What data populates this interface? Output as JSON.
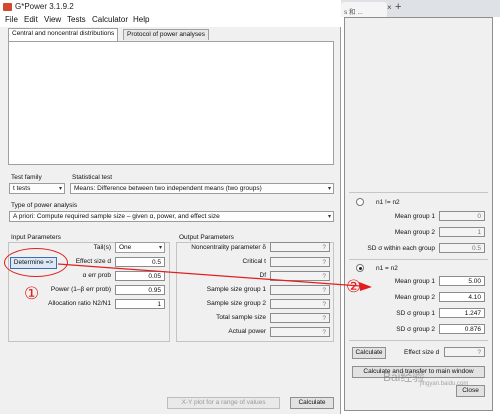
{
  "main_window": {
    "title": "G*Power 3.1.9.2",
    "menu": [
      "File",
      "Edit",
      "View",
      "Tests",
      "Calculator",
      "Help"
    ],
    "tabs": [
      "Central and noncentral distributions",
      "Protocol of power analyses"
    ],
    "test_family_label": "Test family",
    "test_family_value": "t tests",
    "statistical_test_label": "Statistical test",
    "statistical_test_value": "Means: Difference between two independent means (two groups)",
    "type_of_analysis_label": "Type of power analysis",
    "type_of_analysis_value": "A priori: Compute required sample size – given α, power, and effect size",
    "input_params_title": "Input Parameters",
    "output_params_title": "Output Parameters",
    "inputs": [
      {
        "label": "Tail(s)",
        "value": "One"
      },
      {
        "label": "Effect size d",
        "value": "0.5"
      },
      {
        "label": "α err prob",
        "value": "0.05"
      },
      {
        "label": "Power (1–β err prob)",
        "value": "0.95"
      },
      {
        "label": "Allocation ratio N2/N1",
        "value": "1"
      }
    ],
    "outputs": [
      {
        "label": "Noncentrality parameter δ",
        "value": "?"
      },
      {
        "label": "Critical t",
        "value": "?"
      },
      {
        "label": "Df",
        "value": "?"
      },
      {
        "label": "Sample size group 1",
        "value": "?"
      },
      {
        "label": "Sample size group 2",
        "value": "?"
      },
      {
        "label": "Total sample size",
        "value": "?"
      },
      {
        "label": "Actual power",
        "value": "?"
      }
    ],
    "determine_label": "Determine =>",
    "xy_plot_label": "X-Y plot for a range of values",
    "calculate_label": "Calculate"
  },
  "browser": {
    "tab_text": "s 和 ...",
    "tab_close": "×",
    "new_tab": "+"
  },
  "side_panel": {
    "option_unequal": "n1 != n2",
    "unequal_fields": [
      {
        "label": "Mean group 1",
        "value": "0"
      },
      {
        "label": "Mean group 2",
        "value": "1"
      },
      {
        "label": "SD σ within each group",
        "value": "0.5"
      }
    ],
    "option_equal": "n1 = n2",
    "equal_fields": [
      {
        "label": "Mean group 1",
        "value": "5.00"
      },
      {
        "label": "Mean group 2",
        "value": "4.10"
      },
      {
        "label": "SD σ group 1",
        "value": "1.247"
      },
      {
        "label": "SD σ group 2",
        "value": "0.876"
      }
    ],
    "calculate_label": "Calculate",
    "effect_size_label": "Effect size d",
    "effect_size_value": "?",
    "calc_transfer_label": "Calculate and transfer to main window",
    "close_label": "Close"
  },
  "annotations": {
    "marker_1": "①",
    "marker_2": "②",
    "watermark": "Bai经验",
    "watermark_sub": "jingyan.baidu.com"
  },
  "colors": {
    "annotation_red": "#e02020",
    "determine_button_border": "#3c6fb0"
  }
}
